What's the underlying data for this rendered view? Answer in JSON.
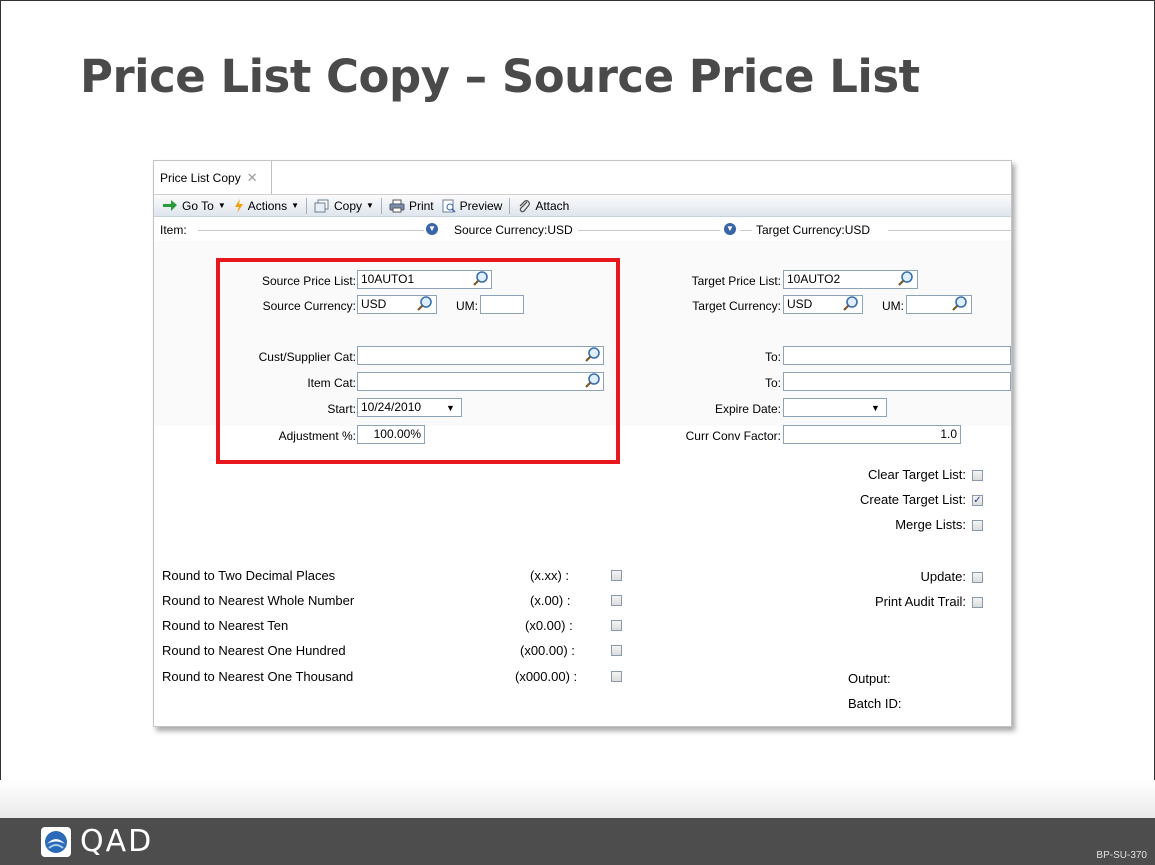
{
  "slide": {
    "title": "Price List Copy – Source Price List",
    "logo_text": "QAD",
    "code": "BP-SU-370"
  },
  "app": {
    "tab_label": "Price List Copy",
    "toolbar": {
      "goto": "Go To",
      "actions": "Actions",
      "copy": "Copy",
      "print": "Print",
      "preview": "Preview",
      "attach": "Attach"
    },
    "filter": {
      "item": "Item:",
      "source_currency": "Source Currency:USD",
      "target_currency": "Target Currency:USD"
    },
    "source": {
      "price_list_label": "Source Price List:",
      "price_list_value": "10AUTO1",
      "currency_label": "Source Currency:",
      "currency_value": "USD",
      "um_label": "UM:",
      "um_value": "",
      "cust_cat_label": "Cust/Supplier Cat:",
      "cust_cat_value": "",
      "item_cat_label": "Item Cat:",
      "item_cat_value": "",
      "start_label": "Start:",
      "start_value": "10/24/2010",
      "adjustment_label": "Adjustment %:",
      "adjustment_value": "100.00%"
    },
    "target": {
      "price_list_label": "Target Price List:",
      "price_list_value": "10AUTO2",
      "currency_label": "Target Currency:",
      "currency_value": "USD",
      "um_label": "UM:",
      "um_value": "",
      "to1_label": "To:",
      "to1_value": "",
      "to2_label": "To:",
      "to2_value": "",
      "expire_label": "Expire Date:",
      "expire_value": "",
      "conv_label": "Curr Conv Factor:",
      "conv_value": "1.0"
    },
    "options": {
      "clear_target": {
        "label": "Clear Target List:",
        "checked": false
      },
      "create_target": {
        "label": "Create Target List:",
        "checked": true
      },
      "merge_lists": {
        "label": "Merge Lists:",
        "checked": false
      },
      "update": {
        "label": "Update:",
        "checked": false
      },
      "print_audit": {
        "label": "Print Audit Trail:",
        "checked": false
      },
      "output_label": "Output:",
      "batch_label": "Batch ID:"
    },
    "rounding": [
      {
        "label": "Round to Two Decimal Places",
        "format": "(x.xx) :"
      },
      {
        "label": "Round to Nearest Whole Number",
        "format": "(x.00) :"
      },
      {
        "label": "Round to Nearest Ten",
        "format": "(x0.00) :"
      },
      {
        "label": "Round to Nearest One Hundred",
        "format": "(x00.00) :"
      },
      {
        "label": "Round to Nearest One Thousand",
        "format": "(x000.00) :"
      }
    ]
  }
}
